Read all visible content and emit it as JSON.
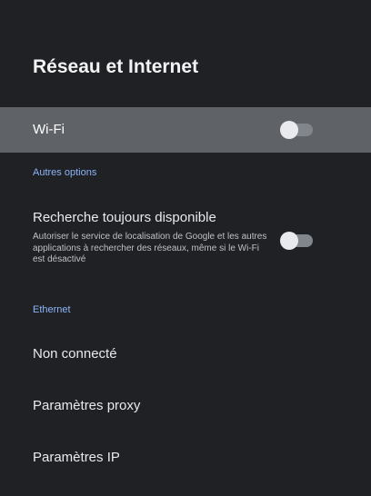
{
  "page": {
    "title": "Réseau et Internet"
  },
  "wifi": {
    "label": "Wi-Fi",
    "toggle_on": false
  },
  "autres_options": {
    "header": "Autres options",
    "recherche": {
      "label": "Recherche toujours disponible",
      "description": "Autoriser le service de localisation de Google et les autres applications à rechercher des réseaux, même si le Wi-Fi est désactivé",
      "toggle_on": false
    }
  },
  "ethernet": {
    "header": "Ethernet",
    "status": "Non connecté",
    "proxy_label": "Paramètres proxy",
    "ip_label": "Paramètres IP"
  },
  "colors": {
    "background": "#202124",
    "selected_row": "#5f6368",
    "section_header": "#8ab4f8",
    "toggle_off_track": "#80868b",
    "toggle_off_knob": "#e8eaed"
  }
}
